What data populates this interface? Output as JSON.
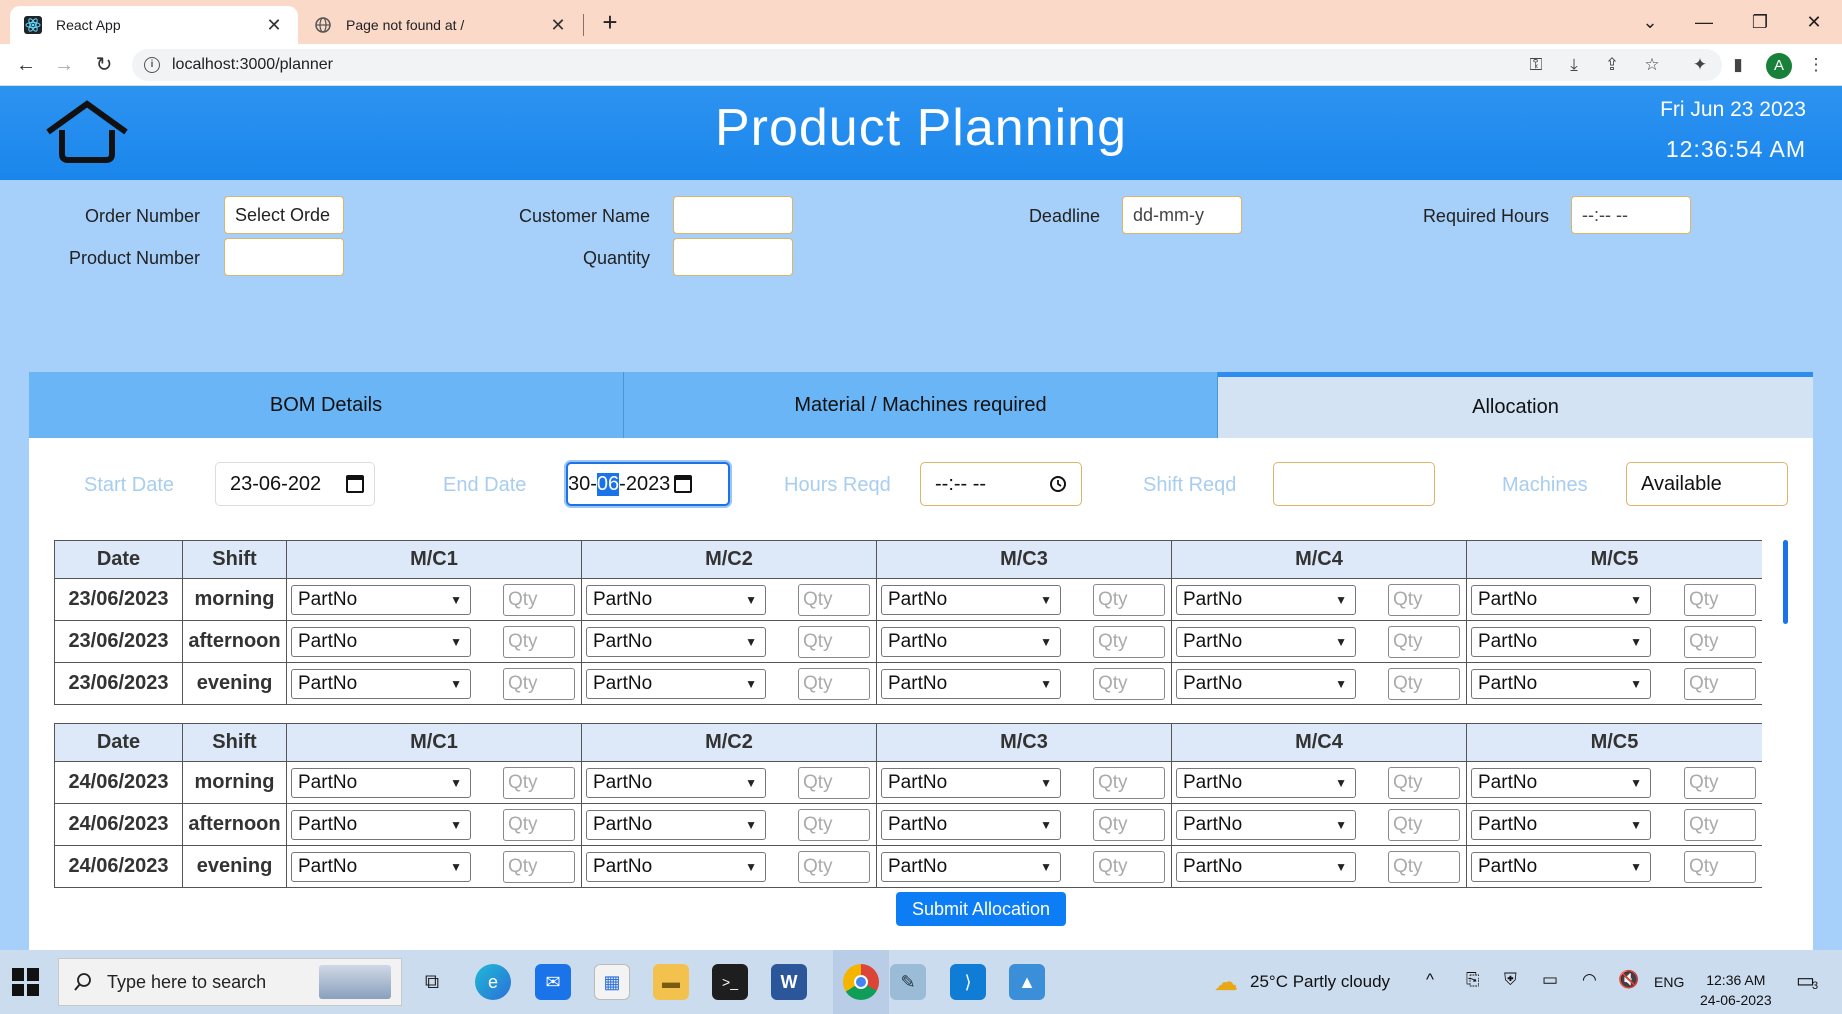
{
  "browser": {
    "tabs": [
      {
        "title": "React App",
        "active": true
      },
      {
        "title": "Page not found at /",
        "active": false
      }
    ],
    "url": "localhost:3000/planner",
    "profile_initial": "A"
  },
  "header": {
    "title": "Product Planning",
    "date": "Fri Jun 23 2023",
    "time": "12:36:54 AM"
  },
  "order_form": {
    "order_number": {
      "label": "Order Number",
      "value": "Select Orde"
    },
    "product_number": {
      "label": "Product Number",
      "value": ""
    },
    "customer_name": {
      "label": "Customer Name",
      "value": ""
    },
    "quantity": {
      "label": "Quantity",
      "value": ""
    },
    "deadline": {
      "label": "Deadline",
      "value": "dd-mm-y"
    },
    "required_hours": {
      "label": "Required Hours",
      "value": "--:-- --"
    }
  },
  "panel_tabs": [
    "BOM Details",
    "Material / Machines required",
    "Allocation"
  ],
  "active_tab": "Allocation",
  "allocation": {
    "start_date": {
      "label": "Start Date",
      "value": "23-06-202"
    },
    "end_date": {
      "label": "End Date",
      "value_pre": "30-",
      "value_sel": "06",
      "value_post": "-2023"
    },
    "hours_reqd": {
      "label": "Hours Reqd",
      "value": "--:-- --"
    },
    "shift_reqd": {
      "label": "Shift Reqd",
      "value": ""
    },
    "machines": {
      "label": "Machines",
      "value": "Available"
    },
    "columns": [
      "Date",
      "Shift",
      "M/C1",
      "M/C2",
      "M/C3",
      "M/C4",
      "M/C5"
    ],
    "part_placeholder": "PartNo",
    "qty_placeholder": "Qty",
    "days": [
      {
        "date": "23/06/2023",
        "shifts": [
          "morning",
          "afternoon",
          "evening"
        ]
      },
      {
        "date": "24/06/2023",
        "shifts": [
          "morning",
          "afternoon",
          "evening"
        ]
      }
    ],
    "submit_label": "Submit Allocation"
  },
  "taskbar": {
    "search_placeholder": "Type here to search",
    "weather": "25°C  Partly cloudy",
    "language": "ENG",
    "time": "12:36 AM",
    "date": "24-06-2023",
    "notification_count": "3"
  },
  "colors": {
    "header_blue": "#1a86ec",
    "form_bg": "#a6d0fa",
    "tab_blue": "#6ab5f6",
    "active_tab_bg": "#d3e3f3",
    "submit_blue": "#0d7df5"
  }
}
